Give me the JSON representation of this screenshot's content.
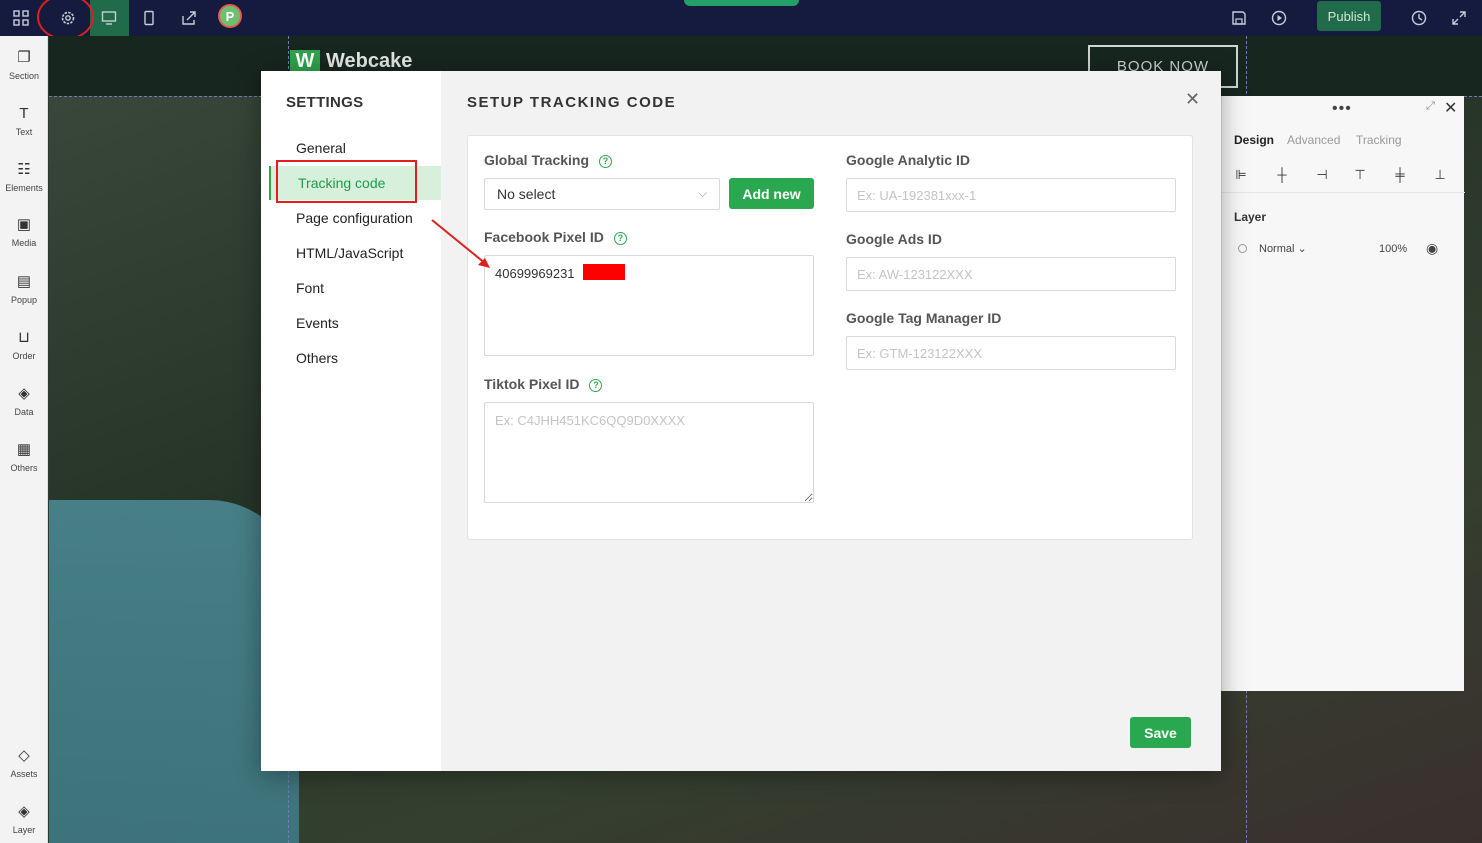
{
  "topbar": {
    "icons": [
      "grid-icon",
      "gear-icon",
      "desktop-icon",
      "mobile-icon",
      "share-icon"
    ],
    "avatar_letter": "P",
    "publish_label": "Publish",
    "right_icons": [
      "save-icon",
      "preview-icon",
      "history-icon",
      "fullscreen-icon"
    ]
  },
  "sidebar": {
    "items": [
      {
        "label": "Section",
        "icon": "section-icon"
      },
      {
        "label": "Text",
        "icon": "text-icon"
      },
      {
        "label": "Elements",
        "icon": "elements-icon"
      },
      {
        "label": "Media",
        "icon": "media-icon"
      },
      {
        "label": "Popup",
        "icon": "popup-icon"
      },
      {
        "label": "Order",
        "icon": "cart-icon"
      },
      {
        "label": "Data",
        "icon": "layers-icon"
      },
      {
        "label": "Others",
        "icon": "others-icon"
      },
      {
        "label": "Assets",
        "icon": "assets-icon"
      },
      {
        "label": "Layer",
        "icon": "layer-icon"
      }
    ]
  },
  "canvas": {
    "logo_letter": "W",
    "logo_text": "Webcake",
    "book_now_label": "BOOK NOW"
  },
  "right_panel": {
    "tabs": [
      "Design",
      "Advanced",
      "Tracking"
    ],
    "layer_title": "Layer",
    "blend_mode": "Normal",
    "opacity": "100%"
  },
  "settings": {
    "title": "SETTINGS",
    "nav": [
      {
        "label": "General"
      },
      {
        "label": "Tracking code"
      },
      {
        "label": "Page configuration"
      },
      {
        "label": "HTML/JavaScript"
      },
      {
        "label": "Font"
      },
      {
        "label": "Events"
      },
      {
        "label": "Others"
      }
    ],
    "active_nav": "Tracking code"
  },
  "tracking": {
    "title": "SETUP TRACKING CODE",
    "global_tracking_label": "Global Tracking",
    "global_tracking_value": "No select",
    "add_new_label": "Add new",
    "facebook_label": "Facebook Pixel ID",
    "facebook_value": "40699969231",
    "tiktok_label": "Tiktok Pixel ID",
    "tiktok_placeholder": "Ex: C4JHH451KC6QQ9D0XXXX",
    "ga_label": "Google Analytic ID",
    "ga_placeholder": "Ex: UA-192381xxx-1",
    "ads_label": "Google Ads ID",
    "ads_placeholder": "Ex: AW-123122XXX",
    "gtm_label": "Google Tag Manager ID",
    "gtm_placeholder": "Ex: GTM-123122XXX",
    "save_label": "Save"
  },
  "colors": {
    "accent": "#2aa84f",
    "topbar": "#141b3e",
    "annotation_red": "#e0201c"
  }
}
